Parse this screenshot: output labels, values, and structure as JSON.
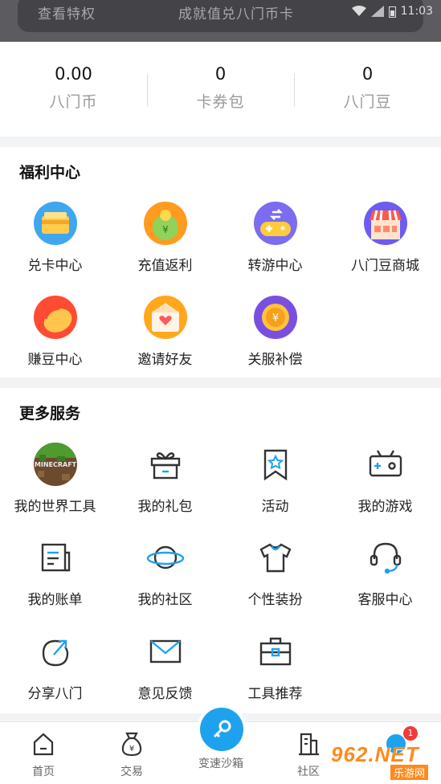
{
  "header": {
    "vip_perks": "查看特权",
    "vip_redeem": "成就值兑八门币卡",
    "status_time": "11:03"
  },
  "stats": [
    {
      "value": "0.00",
      "label": "八门币"
    },
    {
      "value": "0",
      "label": "卡券包"
    },
    {
      "value": "0",
      "label": "八门豆"
    }
  ],
  "welfare": {
    "title": "福利中心",
    "items": [
      {
        "label": "兑卡中心",
        "icon": "card-exchange-icon"
      },
      {
        "label": "充值返利",
        "icon": "recharge-rebate-icon"
      },
      {
        "label": "转游中心",
        "icon": "game-transfer-icon"
      },
      {
        "label": "八门豆商城",
        "icon": "bean-mall-icon"
      },
      {
        "label": "赚豆中心",
        "icon": "earn-beans-icon"
      },
      {
        "label": "邀请好友",
        "icon": "invite-friends-icon"
      },
      {
        "label": "关服补偿",
        "icon": "server-close-compensation-icon"
      }
    ]
  },
  "services": {
    "title": "更多服务",
    "items": [
      {
        "label": "我的世界工具",
        "icon": "minecraft-icon",
        "logo_text": "MINECRAFT"
      },
      {
        "label": "我的礼包",
        "icon": "gift-icon"
      },
      {
        "label": "活动",
        "icon": "activity-bookmark-icon"
      },
      {
        "label": "我的游戏",
        "icon": "game-console-icon"
      },
      {
        "label": "我的账单",
        "icon": "bill-icon"
      },
      {
        "label": "我的社区",
        "icon": "planet-icon"
      },
      {
        "label": "个性装扮",
        "icon": "tshirt-icon"
      },
      {
        "label": "客服中心",
        "icon": "headset-icon"
      },
      {
        "label": "分享八门",
        "icon": "share-icon"
      },
      {
        "label": "意见反馈",
        "icon": "mail-icon"
      },
      {
        "label": "工具推荐",
        "icon": "toolbox-icon"
      }
    ]
  },
  "tabbar": {
    "home": "首页",
    "trade": "交易",
    "sandbox": "变速沙箱",
    "community": "社区",
    "badge": "1"
  },
  "watermark": {
    "logo": "962.NET",
    "sub": "乐游网"
  },
  "colors": {
    "accent": "#1fa2ee",
    "badge": "#f03b3b"
  }
}
